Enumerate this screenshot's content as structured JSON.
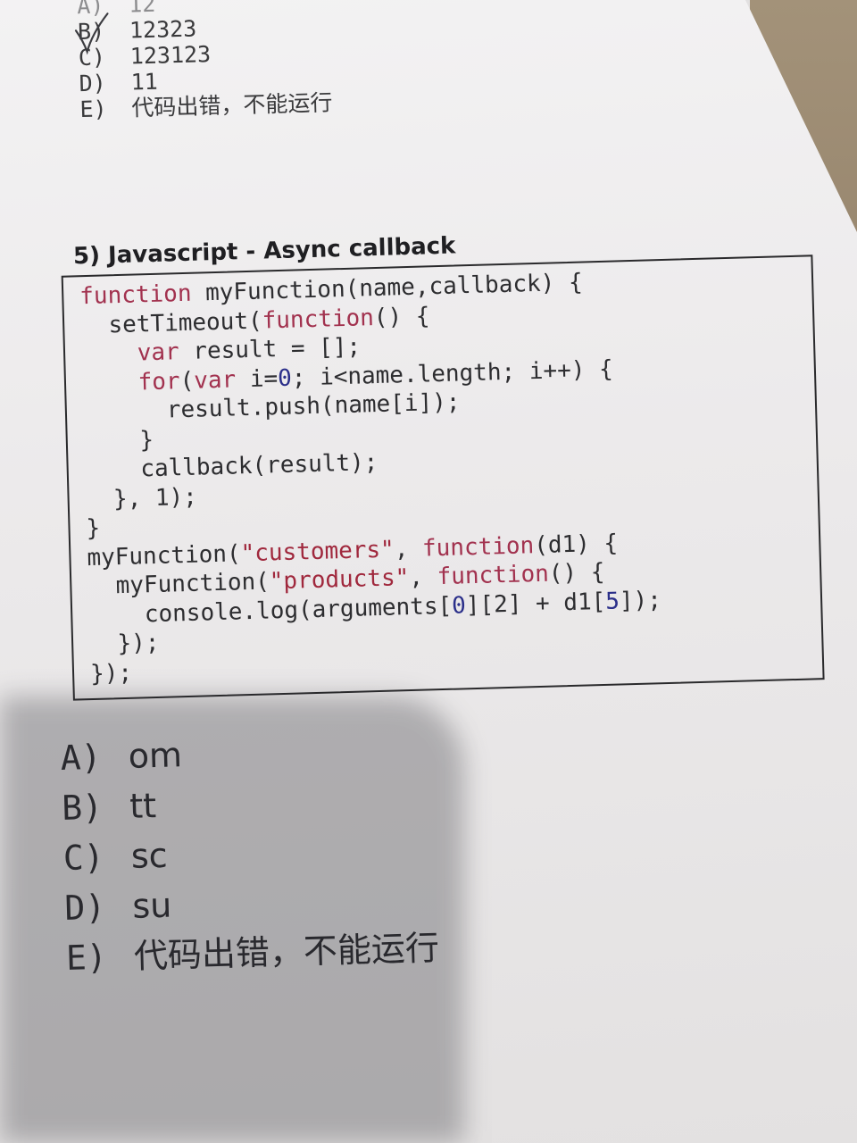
{
  "top_options": [
    {
      "letter": "A)",
      "text": "12"
    },
    {
      "letter": "B)",
      "text": "12323"
    },
    {
      "letter": "C)",
      "text": "123123"
    },
    {
      "letter": "D)",
      "text": "11"
    },
    {
      "letter": "E)",
      "text": "代码出错，不能运行"
    }
  ],
  "question": {
    "title": "5) Javascript - Async callback"
  },
  "answers": [
    {
      "letter": "A)",
      "text": "om"
    },
    {
      "letter": "B)",
      "text": "tt"
    },
    {
      "letter": "C)",
      "text": "sc"
    },
    {
      "letter": "D)",
      "text": "su"
    },
    {
      "letter": "E)",
      "text": "代码出错，不能运行"
    }
  ],
  "colors": {
    "keyword": "#a2324f",
    "string": "#a0283d",
    "number": "#2b2f8a",
    "text": "#2d2d30",
    "check_mark": "#3b3b40"
  }
}
